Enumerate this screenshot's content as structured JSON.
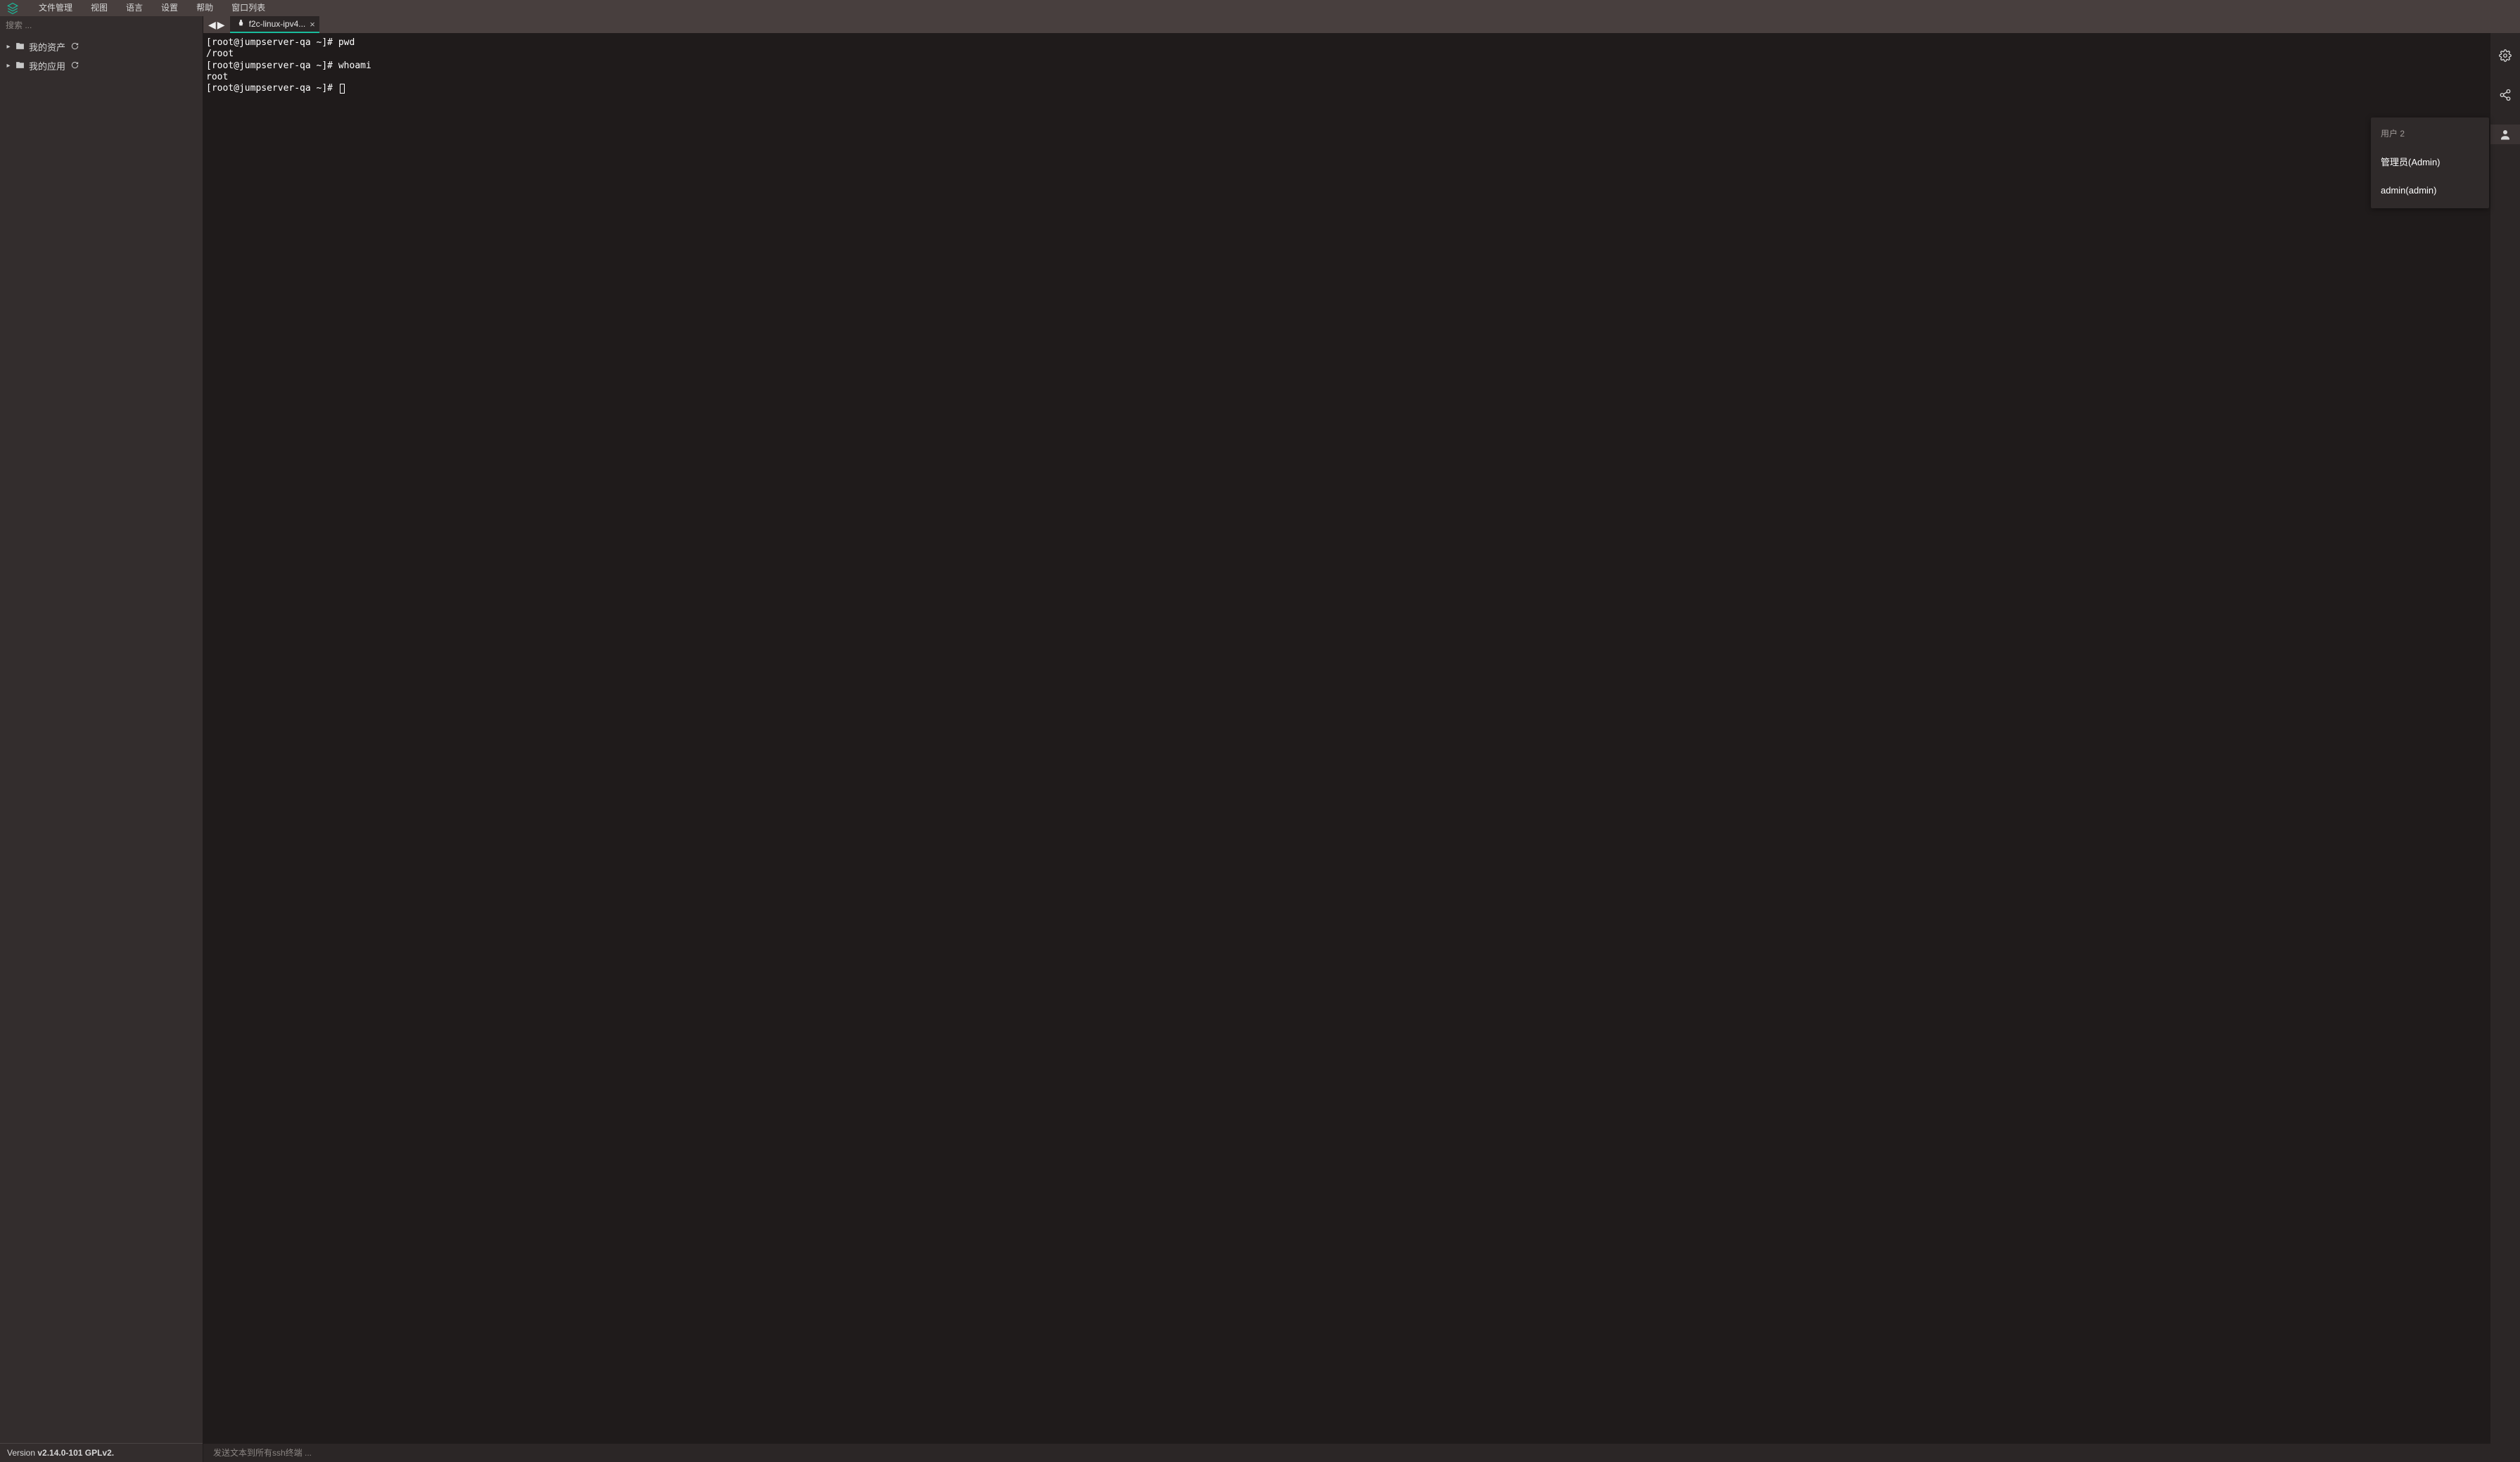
{
  "menubar": {
    "items": [
      "文件管理",
      "视图",
      "语言",
      "设置",
      "帮助",
      "窗口列表"
    ]
  },
  "sidebar": {
    "search_placeholder": "搜索 ...",
    "nodes": [
      {
        "label": "我的资产"
      },
      {
        "label": "我的应用"
      }
    ],
    "version_prefix": "Version ",
    "version": "v2.14.0-101 GPLv2."
  },
  "tabs": {
    "active": {
      "label": "f2c-linux-ipv4..."
    }
  },
  "terminal": {
    "lines": [
      "[root@jumpserver-qa ~]# pwd",
      "/root",
      "[root@jumpserver-qa ~]# whoami",
      "root",
      "[root@jumpserver-qa ~]# "
    ]
  },
  "user_panel": {
    "title_prefix": "用户 ",
    "count": "2",
    "users": [
      "管理员(Admin)",
      "admin(admin)"
    ]
  },
  "send_bar": {
    "placeholder": "发送文本到所有ssh终端 ..."
  }
}
